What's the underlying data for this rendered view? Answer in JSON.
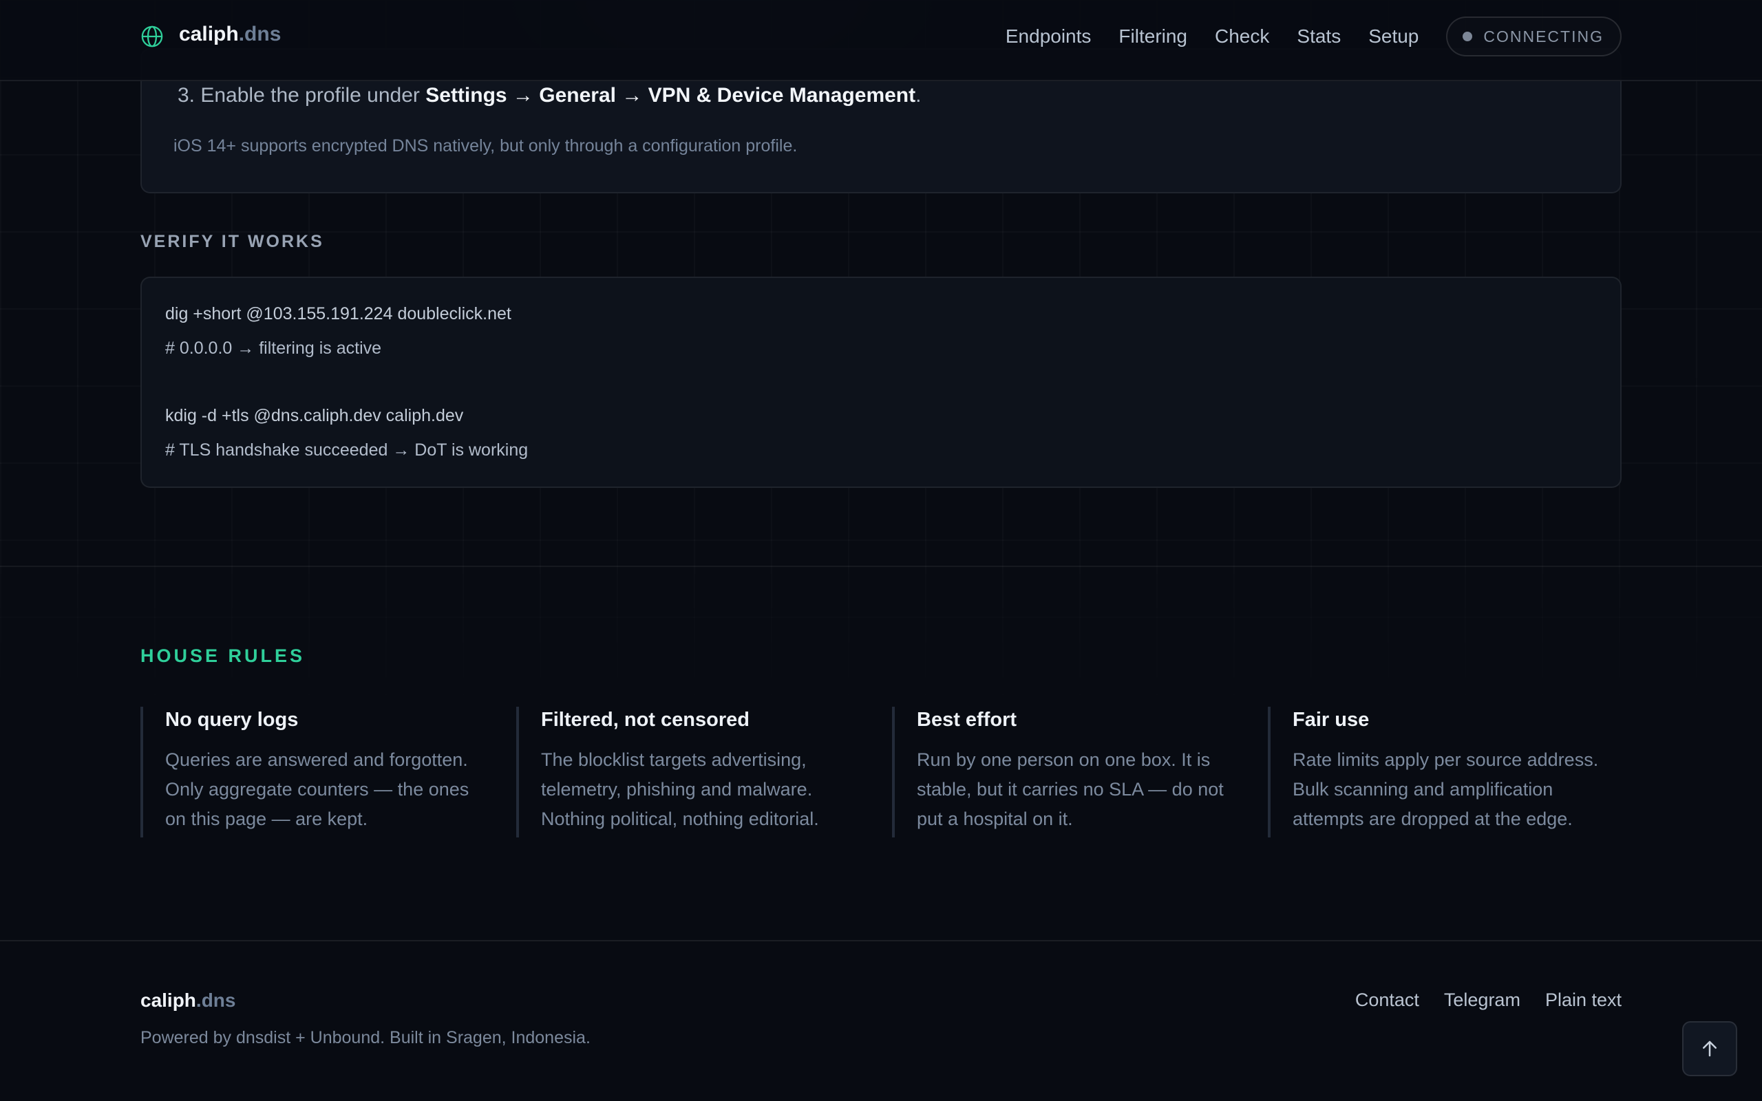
{
  "header": {
    "brand_main": "caliph",
    "brand_suffix": ".dns",
    "nav": [
      "Endpoints",
      "Filtering",
      "Check",
      "Stats",
      "Setup"
    ],
    "status": "CONNECTING"
  },
  "ios": {
    "step_prefix": "3. Enable the profile under ",
    "step_path": "Settings → General → VPN & Device Management",
    "step_suffix": ".",
    "note": "iOS 14+ supports encrypted DNS natively, but only through a configuration profile."
  },
  "verify": {
    "title": "VERIFY IT WORKS",
    "lines": [
      "dig +short @103.155.191.224 doubleclick.net",
      "# 0.0.0.0  → filtering is active",
      "kdig -d +tls @dns.caliph.dev caliph.dev",
      "# TLS handshake succeeded → DoT is working"
    ]
  },
  "rules": {
    "title": "HOUSE RULES",
    "items": [
      {
        "title": "No query logs",
        "body": "Queries are answered and forgotten. Only aggregate counters — the ones on this page — are kept."
      },
      {
        "title": "Filtered, not censored",
        "body": "The blocklist targets advertising, telemetry, phishing and malware. Nothing political, nothing editorial."
      },
      {
        "title": "Best effort",
        "body": "Run by one person on one box. It is stable, but it carries no SLA — do not put a hospital on it."
      },
      {
        "title": "Fair use",
        "body": "Rate limits apply per source address. Bulk scanning and amplification attempts are dropped at the edge."
      }
    ]
  },
  "footer": {
    "brand_main": "caliph",
    "brand_suffix": ".dns",
    "note": "Powered by dnsdist + Unbound. Built in Sragen, Indonesia.",
    "links": [
      "Contact",
      "Telegram",
      "Plain text"
    ]
  },
  "colors": {
    "accent": "#2fcf9a",
    "background": "#080b12"
  },
  "icons": {
    "brand": "globe-icon",
    "to_top": "arrow-up-icon"
  }
}
